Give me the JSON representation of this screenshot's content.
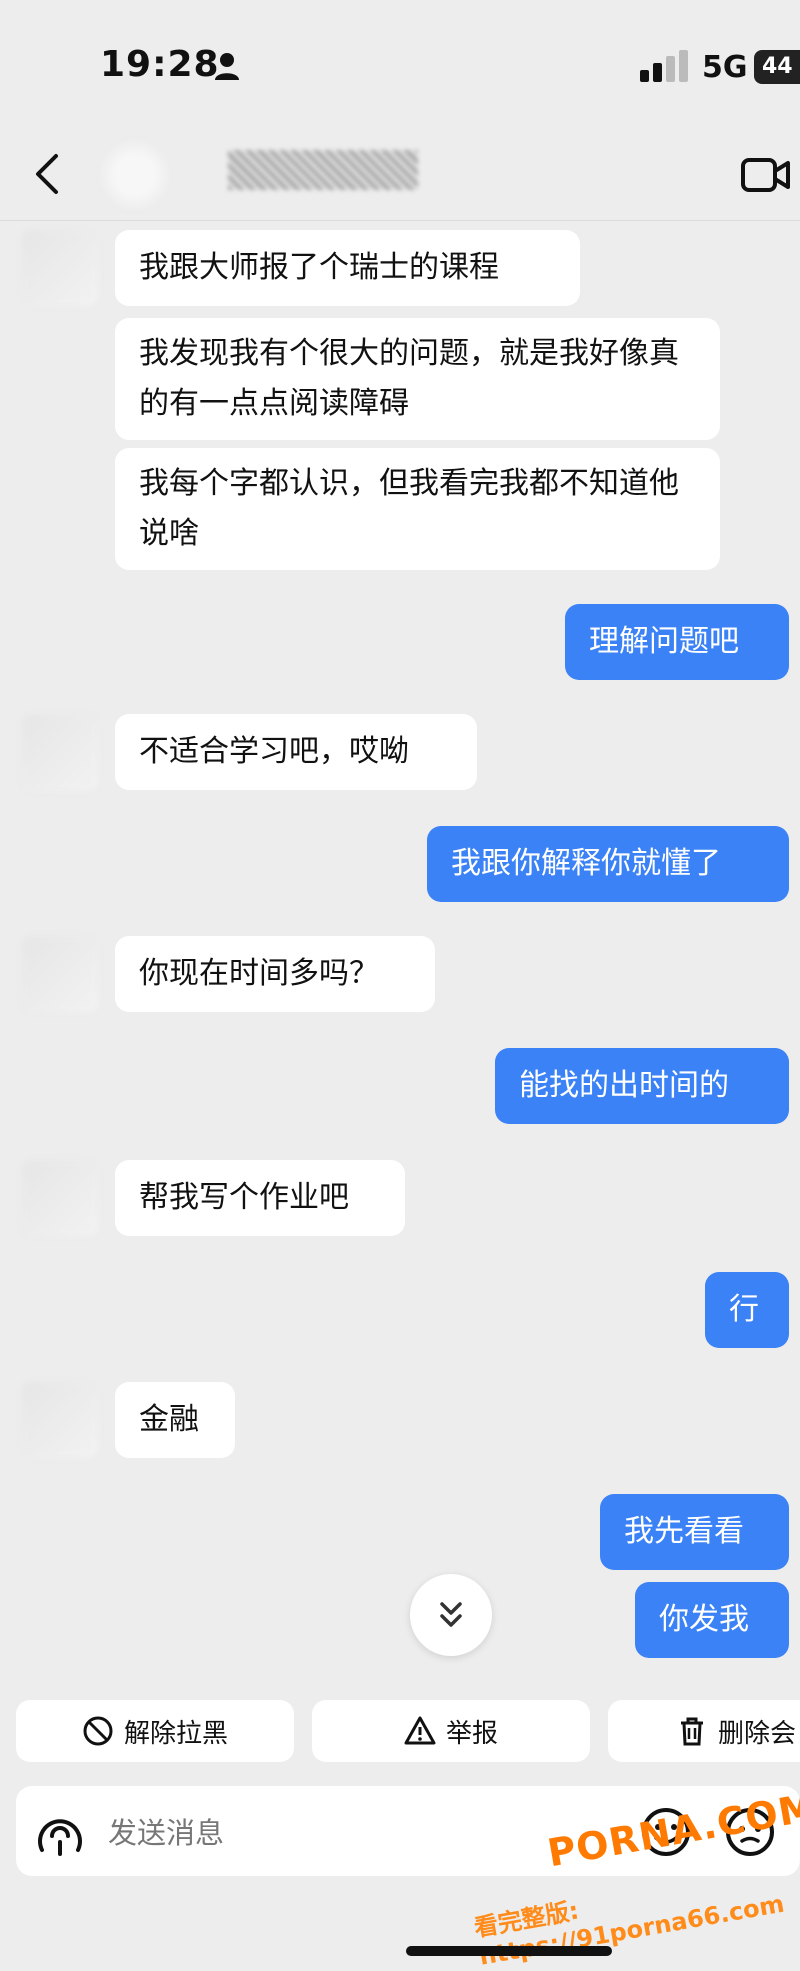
{
  "status_bar": {
    "time": "19:28",
    "network": "5G",
    "battery": "44"
  },
  "nav": {
    "back_icon": "chevron-left-icon",
    "video_icon": "video-camera-icon"
  },
  "messages": [
    {
      "side": "left",
      "text": "我跟大师报了个瑞士的课程"
    },
    {
      "side": "left",
      "text": "我发现我有个很大的问题，就是我好像真的有一点点阅读障碍"
    },
    {
      "side": "left",
      "text": "我每个字都认识，但我看完我都不知道他说啥"
    },
    {
      "side": "right",
      "text": "理解问题吧"
    },
    {
      "side": "left",
      "text": "不适合学习吧，哎呦"
    },
    {
      "side": "right",
      "text": "我跟你解释你就懂了"
    },
    {
      "side": "left",
      "text": "你现在时间多吗？"
    },
    {
      "side": "right",
      "text": "能找的出时间的"
    },
    {
      "side": "left",
      "text": "帮我写个作业吧"
    },
    {
      "side": "right",
      "text": "行"
    },
    {
      "side": "left",
      "text": "金融"
    },
    {
      "side": "right",
      "text": "我先看看"
    },
    {
      "side": "right",
      "text": "你发我"
    }
  ],
  "actions": [
    {
      "label": "解除拉黑",
      "icon": "block-icon"
    },
    {
      "label": "举报",
      "icon": "warning-icon"
    },
    {
      "label": "删除会",
      "icon": "trash-icon"
    }
  ],
  "input": {
    "placeholder": "发送消息"
  },
  "watermark": {
    "logo": "PORNA.COM",
    "url": "看完整版: https://91porna66.com"
  },
  "colors": {
    "background": "#ededed",
    "self_bubble": "#3b82f6",
    "other_bubble": "#ffffff"
  }
}
